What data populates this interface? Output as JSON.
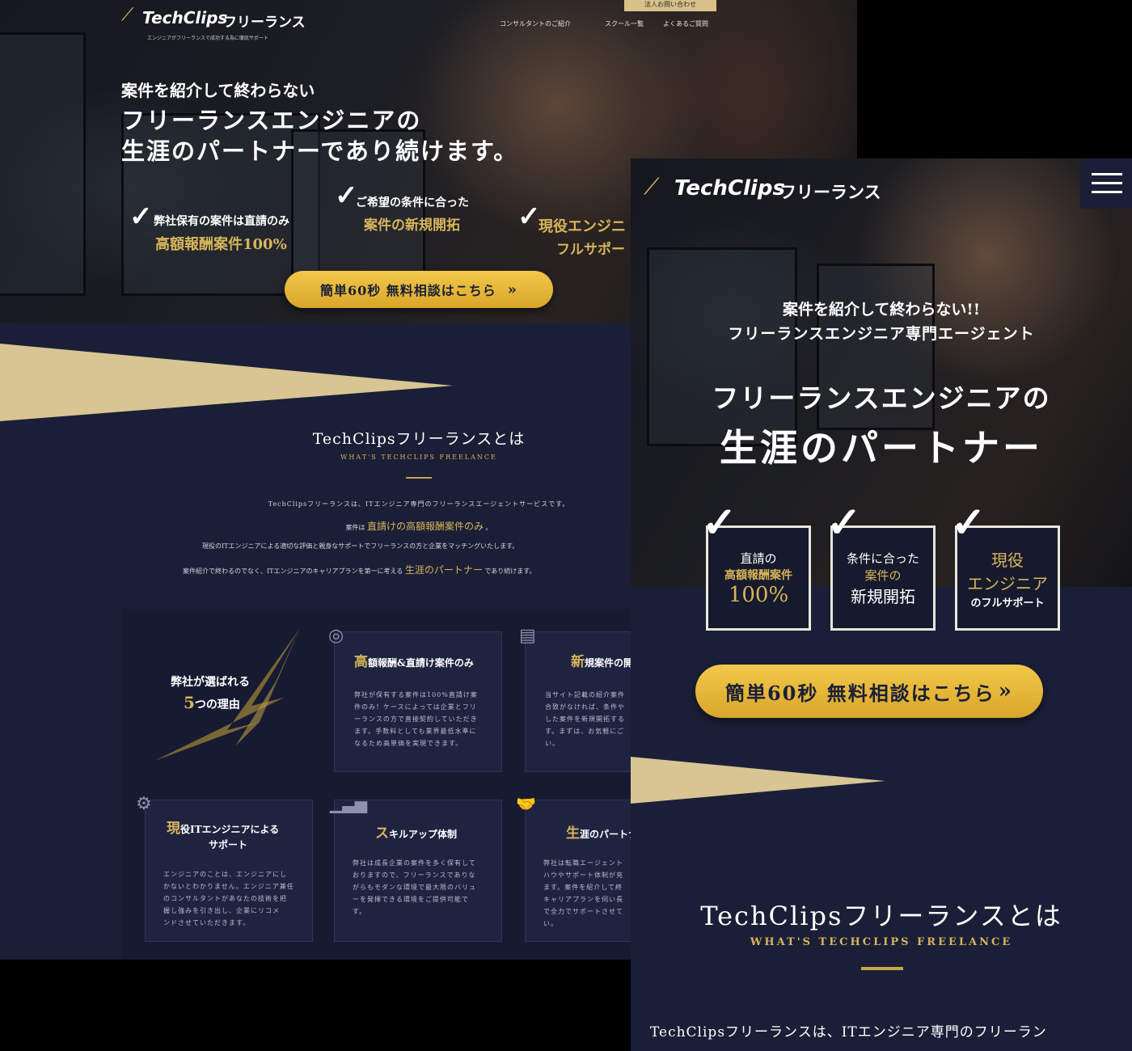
{
  "desktop": {
    "brand": {
      "logo_text": "TechClips",
      "logo_jp": "フリーランス",
      "tagline": "エンジニアがフリーランスで成功する為に徹底サポート"
    },
    "corporate_button": "法人お問い合わせ",
    "nav": [
      "コンサルタントのご紹介",
      "スクール一覧",
      "よくあるご質問"
    ],
    "hero": {
      "lead": "案件を紹介して終わらない",
      "headline_1": "フリーランスエンジニアの",
      "headline_2": "生涯のパートナーであり続けます。",
      "points": [
        {
          "top": "弊社保有の案件は直請のみ",
          "bottom": "高額報酬案件100%"
        },
        {
          "top": "ご希望の条件に合った",
          "bottom": "案件の新規開拓"
        },
        {
          "top": "現役エンジニ",
          "bottom": "フルサポー"
        }
      ],
      "cta": "簡単60秒 無料相談はこちら"
    },
    "about": {
      "title": "TechClipsフリーランスとは",
      "subtitle": "WHAT'S TECHCLIPS FREELANCE",
      "line_1": "TechClipsフリーランスは、ITエンジニア専門のフリーランスエージェントサービスです。",
      "line_2_a": "案件は",
      "line_2_hl": "直請けの高額報酬案件のみ",
      "line_2_b": "。",
      "line_3": "現役のITエンジニアによる適切な評価と親身なサポートでフリーランスの方と企業をマッチングいたします。",
      "line_4_a": "案件紹介で終わるのでなく、ITエンジニアのキャリアプランを第一に考える",
      "line_4_hl": "生涯のパートナー",
      "line_4_b": "であり続けます。"
    },
    "reasons": {
      "heading_1": "弊社が選ばれる",
      "heading_num": "5",
      "heading_2": "つの理由",
      "cards": [
        {
          "icon": "coins-icon",
          "initial": "高",
          "title": "額報酬&直請け案件のみ",
          "text": [
            "弊社が保有する案件は100%直請け案",
            "件のみ！ケースによっては企業とフリ",
            "ーランスの方で直接契約していただき",
            "ます。手数料としても業界最低水準に",
            "なるため高単価を実現できます。"
          ]
        },
        {
          "icon": "document-icon",
          "initial": "新",
          "title": "規案件の開拓",
          "text": [
            "当サイト記載の紹介案件",
            "合致がなければ、条件や",
            "した案件を新規開拓する",
            "す。まずは、お気軽にご",
            "い。"
          ]
        },
        {
          "icon": "gears-icon",
          "initial": "現",
          "title": "役ITエンジニアによる",
          "title_2": "サポート",
          "text": [
            "エンジニアのことは、エンジニアにし",
            "かないとわかりません。エンジニア兼任",
            "のコンサルタントがあなたの技術を把",
            "握し強みを引き出し、企業にリコメ",
            "ンドさせていただきます。"
          ]
        },
        {
          "icon": "bar-chart-icon",
          "initial": "ス",
          "title": "キルアップ体制",
          "text": [
            "弊社は成長企業の案件を多く保有して",
            "おりますので、フリーランスでありな",
            "がらもモダンな環境で最大限のバリュ",
            "ーを発揮できる環境をご提供可能で",
            "す。"
          ]
        },
        {
          "icon": "handshake-icon",
          "initial": "生",
          "title": "涯のパートナー",
          "text": [
            "弊社は転職エージェント",
            "ハウやサポート体制が充",
            "ます。案件を紹介して終",
            "キャリアプランを伺い長",
            "で全力でサポートさせて",
            "い。"
          ]
        }
      ]
    }
  },
  "mobile": {
    "brand": {
      "logo_text": "TechClips",
      "logo_jp": "フリーランス"
    },
    "hero": {
      "lead_1": "案件を紹介して終わらない!!",
      "lead_2": "フリーランスエンジニア専門エージェント",
      "headline_1": "フリーランスエンジニアの",
      "headline_2": "生涯のパートナー",
      "boxes": [
        {
          "l1": "直請の",
          "l2": "高額報酬案件",
          "l3": "100%"
        },
        {
          "l1": "条件に合った",
          "l2": "案件の",
          "l3": "新規開拓"
        },
        {
          "l1": "現役",
          "l2": "エンジニア",
          "l3": "のフルサポート"
        }
      ],
      "cta": "簡単60秒 無料相談はこちら"
    },
    "about": {
      "title": "TechClipsフリーランスとは",
      "subtitle": "WHAT'S TECHCLIPS FREELANCE",
      "line_1": "TechClipsフリーランスは、ITエンジニア専門のフリーラン"
    }
  },
  "colors": {
    "navy": "#1a1f37",
    "gold": "#d8b45a",
    "cta": "#f0c23e"
  }
}
